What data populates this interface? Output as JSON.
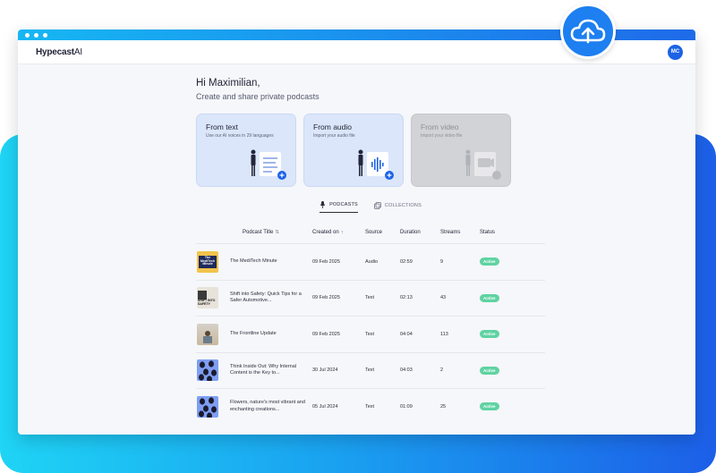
{
  "colors": {
    "accent": "#1c63e6",
    "active_badge": "#5fd3a2"
  },
  "app": {
    "brand_main": "Hypecast",
    "brand_suffix": "AI",
    "avatar_initials": "MC"
  },
  "greeting": {
    "title": "Hi Maximilian,",
    "subtitle": "Create and share private podcasts"
  },
  "cards": [
    {
      "title": "From text",
      "subtitle": "Use our AI voices in 29 languages",
      "state": "enabled"
    },
    {
      "title": "From audio",
      "subtitle": "Import your audio file",
      "state": "enabled"
    },
    {
      "title": "From video",
      "subtitle": "Import your video file",
      "state": "disabled"
    }
  ],
  "tabs": [
    {
      "label": "PODCASTS",
      "icon": "microphone-icon",
      "active": true
    },
    {
      "label": "COLLECTIONS",
      "icon": "collections-icon",
      "active": false
    }
  ],
  "table": {
    "headers": {
      "title": "Podcast Title",
      "created": "Created on",
      "source": "Source",
      "duration": "Duration",
      "streams": "Streams",
      "status": "Status"
    },
    "rows": [
      {
        "thumb_text": "The MediTech Minute",
        "title": "The MediTech Minute",
        "created": "09 Feb 2025",
        "source": "Audio",
        "duration": "02:59",
        "streams": "9",
        "status": "Active"
      },
      {
        "thumb_text": "SHIFT INTO SAFETY",
        "title": "Shift into Safety: Quick Tips for a Safer Automotive...",
        "created": "09 Feb 2025",
        "source": "Text",
        "duration": "02:13",
        "streams": "43",
        "status": "Active"
      },
      {
        "thumb_text": "",
        "title": "The Frontline Update",
        "created": "09 Feb 2025",
        "source": "Text",
        "duration": "04:04",
        "streams": "113",
        "status": "Active"
      },
      {
        "thumb_text": "",
        "title": "Think Inside Out: Why Internal Content is the Key to...",
        "created": "30 Jul 2024",
        "source": "Text",
        "duration": "04:03",
        "streams": "2",
        "status": "Active"
      },
      {
        "thumb_text": "",
        "title": "Flowers, nature's most vibrant and enchanting creations...",
        "created": "05 Jul 2024",
        "source": "Text",
        "duration": "01:09",
        "streams": "25",
        "status": "Active"
      }
    ]
  }
}
